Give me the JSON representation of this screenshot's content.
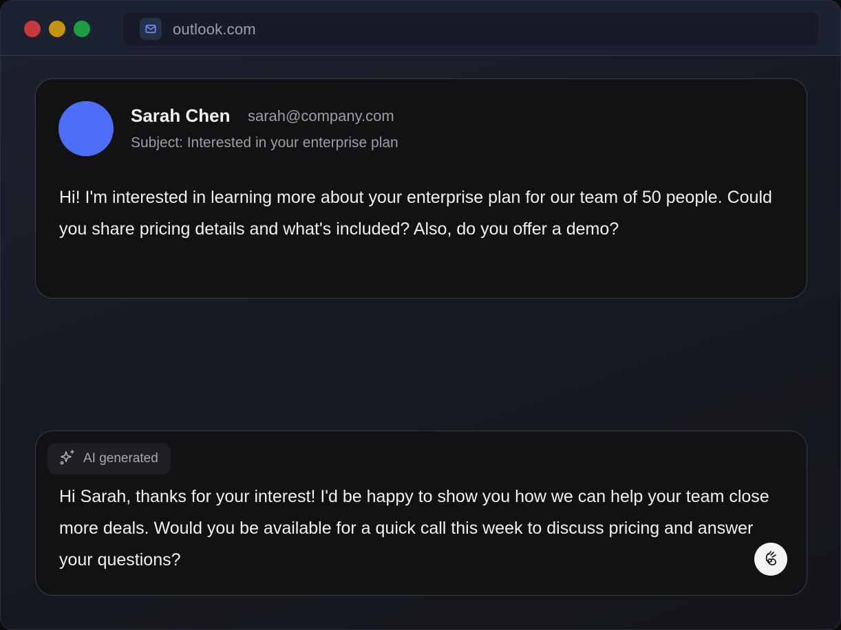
{
  "browser": {
    "url": "outlook.com",
    "site_icon": "mail-icon"
  },
  "email": {
    "sender_name": "Sarah Chen",
    "sender_email": "sarah@company.com",
    "subject": "Subject: Interested in your enterprise plan",
    "body": "Hi! I'm interested in learning more about your enterprise plan for our team of 50 people. Could you share pricing details and what's included? Also, do you offer a demo?",
    "avatar_color": "#4f6ef7"
  },
  "reply": {
    "badge_label": "AI generated",
    "badge_icon": "sparkles-icon",
    "body": "Hi Sarah, thanks for your interest! I'd be happy to show you how we can help your team close more deals. Would you be available for a quick call this week to discuss pricing and answer your questions?",
    "assistant_icon": "hand-gesture-icon"
  },
  "colors": {
    "close": "#c7393e",
    "minimize": "#c39512",
    "maximize": "#1f9d43",
    "accent": "#4f6ef7"
  }
}
